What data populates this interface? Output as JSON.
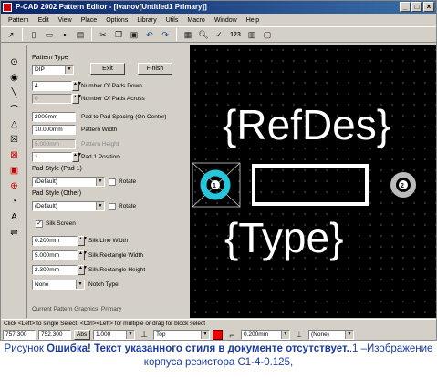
{
  "window": {
    "title": "P-CAD 2002 Pattern Editor - [Ivanov[Untitled1 Primary]]",
    "btn_min": "_",
    "btn_max": "□",
    "btn_close": "×"
  },
  "menu": [
    "Pattern",
    "Edit",
    "View",
    "Place",
    "Options",
    "Library",
    "Utils",
    "Macro",
    "Window",
    "Help"
  ],
  "toolbar": {
    "num_label": "123"
  },
  "panel": {
    "group_title": "Pattern Type",
    "type_value": "DIP",
    "exit_label": "Exit",
    "finish_label": "Finish",
    "pads_down_value": "4",
    "pads_down_label": "Number Of Pads Down",
    "pads_across_value": "0",
    "pads_across_label": "Number Of Pads Across",
    "spacing_value": "2000mm",
    "spacing_label": "Pad to Pad Spacing (On Center)",
    "width_value": "10.000mm",
    "width_label": "Pattern Width",
    "height_value": "5.000mm",
    "height_label": "Pattern Height",
    "pad1_value": "1",
    "pad1_label": "Pad 1 Position",
    "padstyle1_title": "Pad Style (Pad 1)",
    "padstyle1_value": "(Default)",
    "rotate_label": "Rotate",
    "padstyle2_title": "Pad Style (Other)",
    "padstyle2_value": "(Default)",
    "silk_label": "Silk Screen",
    "silk_check": "✓",
    "silk_line_value": "0.200mm",
    "silk_line_label": "Silk Line Width",
    "silk_rect_w_value": "5.000mm",
    "silk_rect_w_label": "Silk Rectangle Width",
    "silk_rect_h_value": "2.300mm",
    "silk_rect_h_label": "Silk Rectangle Height",
    "notch_value": "None",
    "notch_label": "Notch Type",
    "current_graphics": "Current Pattern Graphics: Primary"
  },
  "canvas": {
    "refdes": "{RefDes}",
    "type": "{Type}",
    "pad1_num": "1",
    "pad2_num": "2"
  },
  "statusbar": {
    "hint": "Click <Left> to single Select, <Ctrl><Left> for multiple or drag for block select"
  },
  "bottombar": {
    "coords": "757.300",
    "coord2": "752.300",
    "abs_label": "Abs",
    "grid_value": "1.000",
    "layer_value": "Top",
    "width_value": "0.200mm",
    "style_value": "(None)"
  },
  "caption": {
    "prefix": "Рисунок ",
    "error": "Ошибка! Текст указанного стиля в документе отсутствует.",
    "suffix": ".1 –Изображение корпуса резистора С1-4-0.125,"
  },
  "colors": {
    "canvas_bg": "#000000",
    "pad1_ring": "#26c6da",
    "silkscreen": "#ffffff",
    "caption_text": "#1a3aa0"
  }
}
